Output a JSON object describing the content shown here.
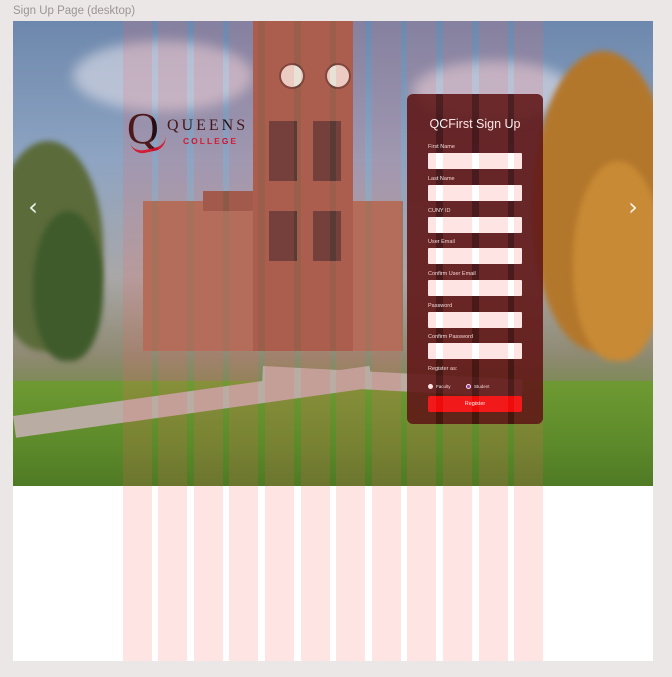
{
  "frame": {
    "label": "Sign Up Page (desktop)"
  },
  "carousel": {
    "prev_icon": "chevron-left-icon",
    "next_icon": "chevron-right-icon",
    "prev_glyph": "‹",
    "next_glyph": "›"
  },
  "logo": {
    "letter": "Q",
    "name": "QUEENS",
    "sub": "COLLEGE"
  },
  "signup": {
    "title": "QCFirst Sign Up",
    "fields": {
      "first_name": "First Name",
      "last_name": "Last Name",
      "cuny_id": "CUNY ID",
      "user_email": "User Email",
      "confirm_email": "Confirm User Email",
      "password": "Password",
      "confirm_password": "Confirm Password"
    },
    "register_as": "Register as:",
    "options": {
      "faculty": "Faculty",
      "student": "Student"
    },
    "selected_option": "Student",
    "register_button": "Register"
  },
  "colors": {
    "card": "#3e0808",
    "button": "#ee0b0b",
    "radio_selected": "#7b2bbf",
    "grid_overlay": "#ff6060",
    "logo_red": "#c8102e"
  }
}
